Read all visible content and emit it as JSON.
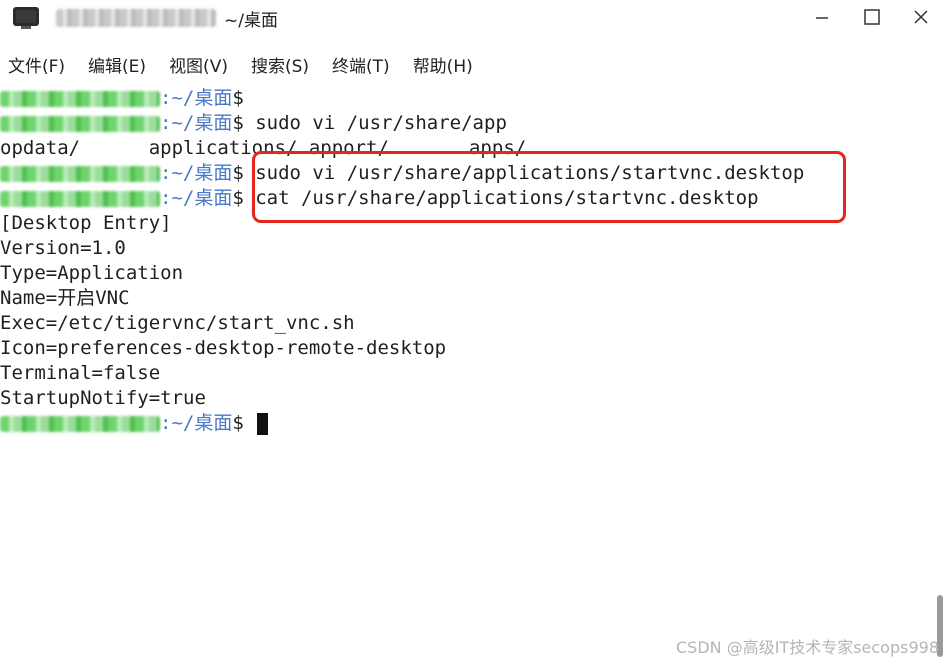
{
  "window": {
    "title_path": "~/桌面",
    "controls": {
      "minimize": "minimize-icon",
      "maximize": "maximize-icon",
      "close": "close-icon"
    }
  },
  "menu": [
    "文件(F)",
    "编辑(E)",
    "视图(V)",
    "搜索(S)",
    "终端(T)",
    "帮助(H)"
  ],
  "terminal": {
    "path": ":~/桌面",
    "prompt_symbol": "$",
    "lines": {
      "l2_cmd": " sudo vi /usr/share/app",
      "l3_out": "opdata/      applications/ apport/       apps/",
      "l4_cmd": " sudo vi /usr/share/applications/startvnc.desktop",
      "l5_cmd": " cat /usr/share/applications/startvnc.desktop",
      "out1": "[Desktop Entry]",
      "out2": "Version=1.0",
      "out3": "Type=Application",
      "out4": "Name=开启VNC",
      "out5": "Exec=/etc/tigervnc/start_vnc.sh",
      "out6": "Icon=preferences-desktop-remote-desktop",
      "out7": "Terminal=false",
      "out8": "StartupNotify=true"
    }
  },
  "colors": {
    "path": "#4a78c8",
    "highlight": "#e6261c",
    "text": "#1f1f1f"
  },
  "watermark": "CSDN @高级IT技术专家secops998"
}
